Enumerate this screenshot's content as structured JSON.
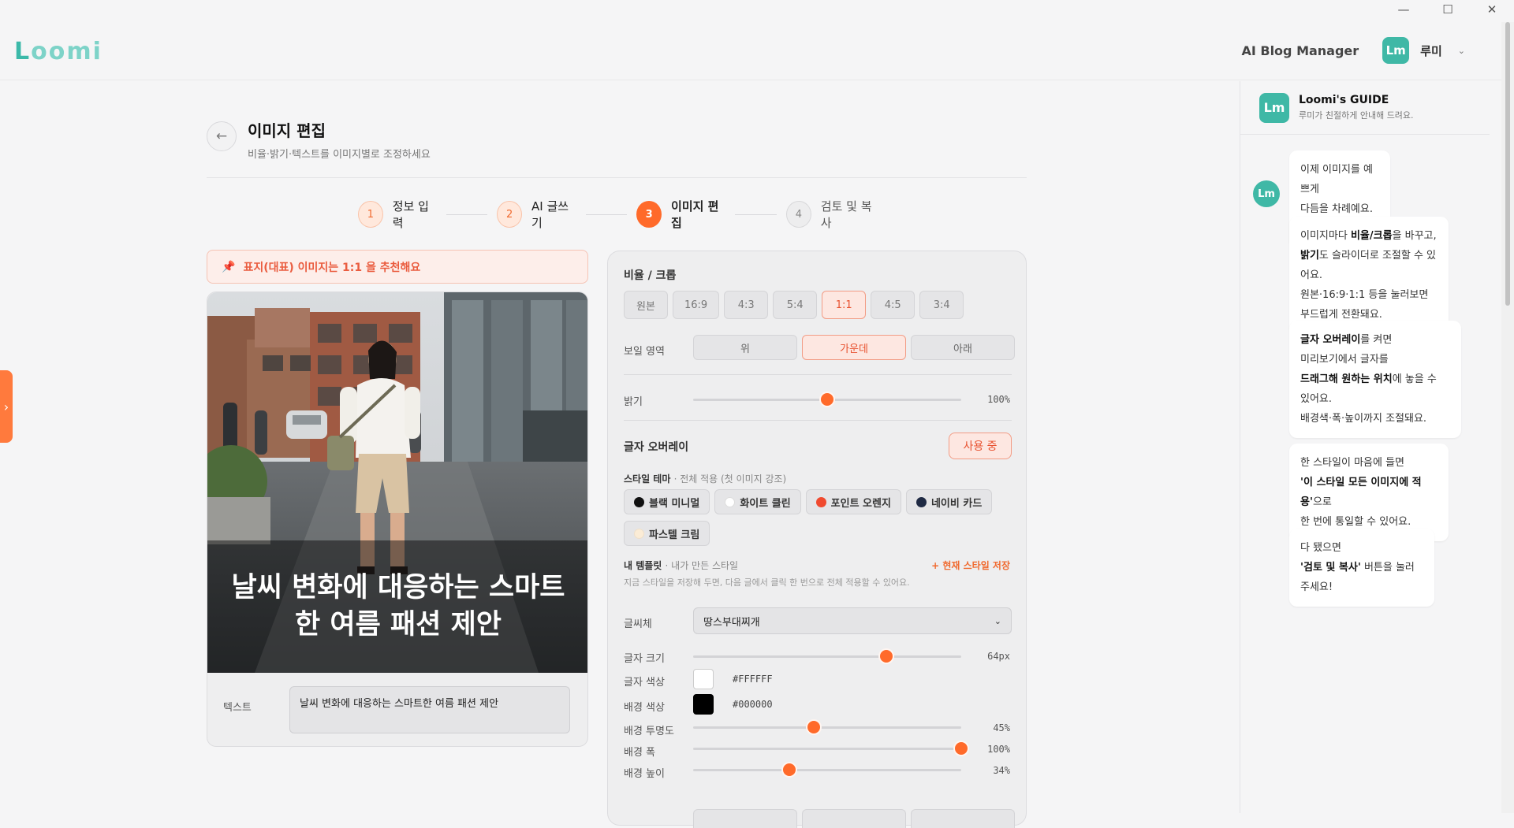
{
  "app": {
    "logo": "Loomi",
    "header_title": "AI Blog Manager",
    "avatar_initials": "Lm",
    "user_name": "루미"
  },
  "page": {
    "title": "이미지 편집",
    "subtitle": "비율·밝기·텍스트를 이미지별로 조정하세요"
  },
  "steps": [
    {
      "num": "1",
      "label": "정보 입력",
      "state": "done"
    },
    {
      "num": "2",
      "label": "AI 글쓰기",
      "state": "done"
    },
    {
      "num": "3",
      "label": "이미지 편집",
      "state": "active"
    },
    {
      "num": "4",
      "label": "검토 및 복사",
      "state": "todo"
    }
  ],
  "notice": "표지(대표) 이미지는 1:1 을 추천해요",
  "preview": {
    "overlay_text": "날씨 변화에 대응하는 스마트한 여름 패션 제안",
    "text_label": "텍스트",
    "text_value": "날씨 변화에 대응하는 스마트한 여름 패션 제안"
  },
  "settings": {
    "ratio_title": "비율 / 크롭",
    "ratios": [
      "원본",
      "16:9",
      "4:3",
      "5:4",
      "1:1",
      "4:5",
      "3:4"
    ],
    "ratio_selected": "1:1",
    "visible_area_label": "보일 영역",
    "visible_area_options": [
      "위",
      "가운데",
      "아래"
    ],
    "visible_area_selected": "가운데",
    "brightness_label": "밝기",
    "brightness_value": "100%",
    "brightness_level": 0.5,
    "overlay_title": "글자 오버레이",
    "overlay_toggle": "사용 중",
    "style_theme_title": "스타일 테마",
    "style_theme_note": "· 전체 적용 (첫 이미지 강조)",
    "themes": [
      {
        "label": "블랙 미니멀",
        "color": "#111111"
      },
      {
        "label": "화이트 클린",
        "color": "#ffffff"
      },
      {
        "label": "포인트 오렌지",
        "color": "#f04a2f"
      },
      {
        "label": "네이비 카드",
        "color": "#1f2a44"
      },
      {
        "label": "파스텔 크림",
        "color": "#fbecd6"
      }
    ],
    "template_title": "내 템플릿",
    "template_note": "· 내가 만든 스타일",
    "template_save": "+ 현재 스타일 저장",
    "template_hint": "지금 스타일을 저장해 두면, 다음 글에서 클릭 한 번으로 전체 적용할 수 있어요.",
    "font_label": "글씨체",
    "font_value": "땅스부대찌개",
    "font_size_label": "글자 크기",
    "font_size_value": "64px",
    "font_size_level": 0.72,
    "text_color_label": "글자 색상",
    "text_color": "#FFFFFF",
    "bg_color_label": "배경 색상",
    "bg_color": "#000000",
    "bg_opacity_label": "배경 투명도",
    "bg_opacity_value": "45%",
    "bg_opacity_level": 0.45,
    "bg_width_label": "배경 폭",
    "bg_width_value": "100%",
    "bg_width_level": 1.0,
    "bg_height_label": "배경 높이",
    "bg_height_value": "34%",
    "bg_height_level": 0.36
  },
  "guide": {
    "title": "Loomi's GUIDE",
    "subtitle": "루미가 친절하게 안내해 드려요.",
    "avatar_initials": "Lm",
    "messages": [
      [
        "이제 이미지를 예쁘게",
        "다듬을 차례예요. 🎨"
      ],
      [
        "이미지마다 ",
        "비율/크롭",
        "을 바꾸고,",
        "밝기",
        "도 슬라이더로 조절할 수 있어요.",
        "원본·16:9·1:1 등을 눌러보면",
        "부드럽게 전환돼요."
      ],
      [
        "글자 오버레이",
        "를 켜면",
        "미리보기에서 글자를",
        "드래그해 원하는 위치",
        "에 놓을 수",
        "있어요.",
        "배경색·폭·높이까지 조절돼요."
      ],
      [
        "한 스타일이 마음에 들면",
        "'이 스타일 모든 이미지에 적용'",
        "으로",
        "한 번에 통일할 수 있어요."
      ],
      [
        "다 됐으면",
        "'검토 및 복사'",
        " 버튼을 눌러주세요!"
      ]
    ]
  },
  "colors": {
    "accent": "#ff6a2a",
    "brand": "#3fb8a6"
  }
}
